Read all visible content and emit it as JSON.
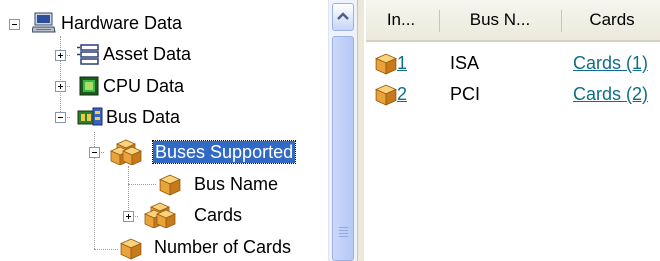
{
  "tree": {
    "root": {
      "label": "Hardware Data",
      "icon": "computer-icon",
      "expanded": true
    },
    "children": [
      {
        "label": "Asset Data",
        "icon": "list-icon",
        "expanded": false
      },
      {
        "label": "CPU Data",
        "icon": "chip-icon",
        "expanded": false
      },
      {
        "label": "Bus Data",
        "icon": "bus-icon",
        "expanded": true,
        "children": [
          {
            "label": "Buses Supported",
            "icon": "cubes-icon",
            "expanded": true,
            "selected": true,
            "children": [
              {
                "label": "Bus Name",
                "icon": "cube-icon"
              },
              {
                "label": "Cards",
                "icon": "cubes-icon",
                "expanded": false
              }
            ]
          },
          {
            "label": "Number of Cards",
            "icon": "cube-icon"
          }
        ]
      }
    ]
  },
  "list": {
    "columns": [
      "In...",
      "Bus N...",
      "Cards"
    ],
    "rows": [
      {
        "index": "1",
        "bus_name": "ISA",
        "cards": "Cards (1)",
        "icon": "cube-icon"
      },
      {
        "index": "2",
        "bus_name": "PCI",
        "cards": "Cards (2)",
        "icon": "cube-icon"
      }
    ]
  },
  "colors": {
    "selection": "#316ac5",
    "link": "#0e6e86",
    "cube": "#e8a33a"
  }
}
